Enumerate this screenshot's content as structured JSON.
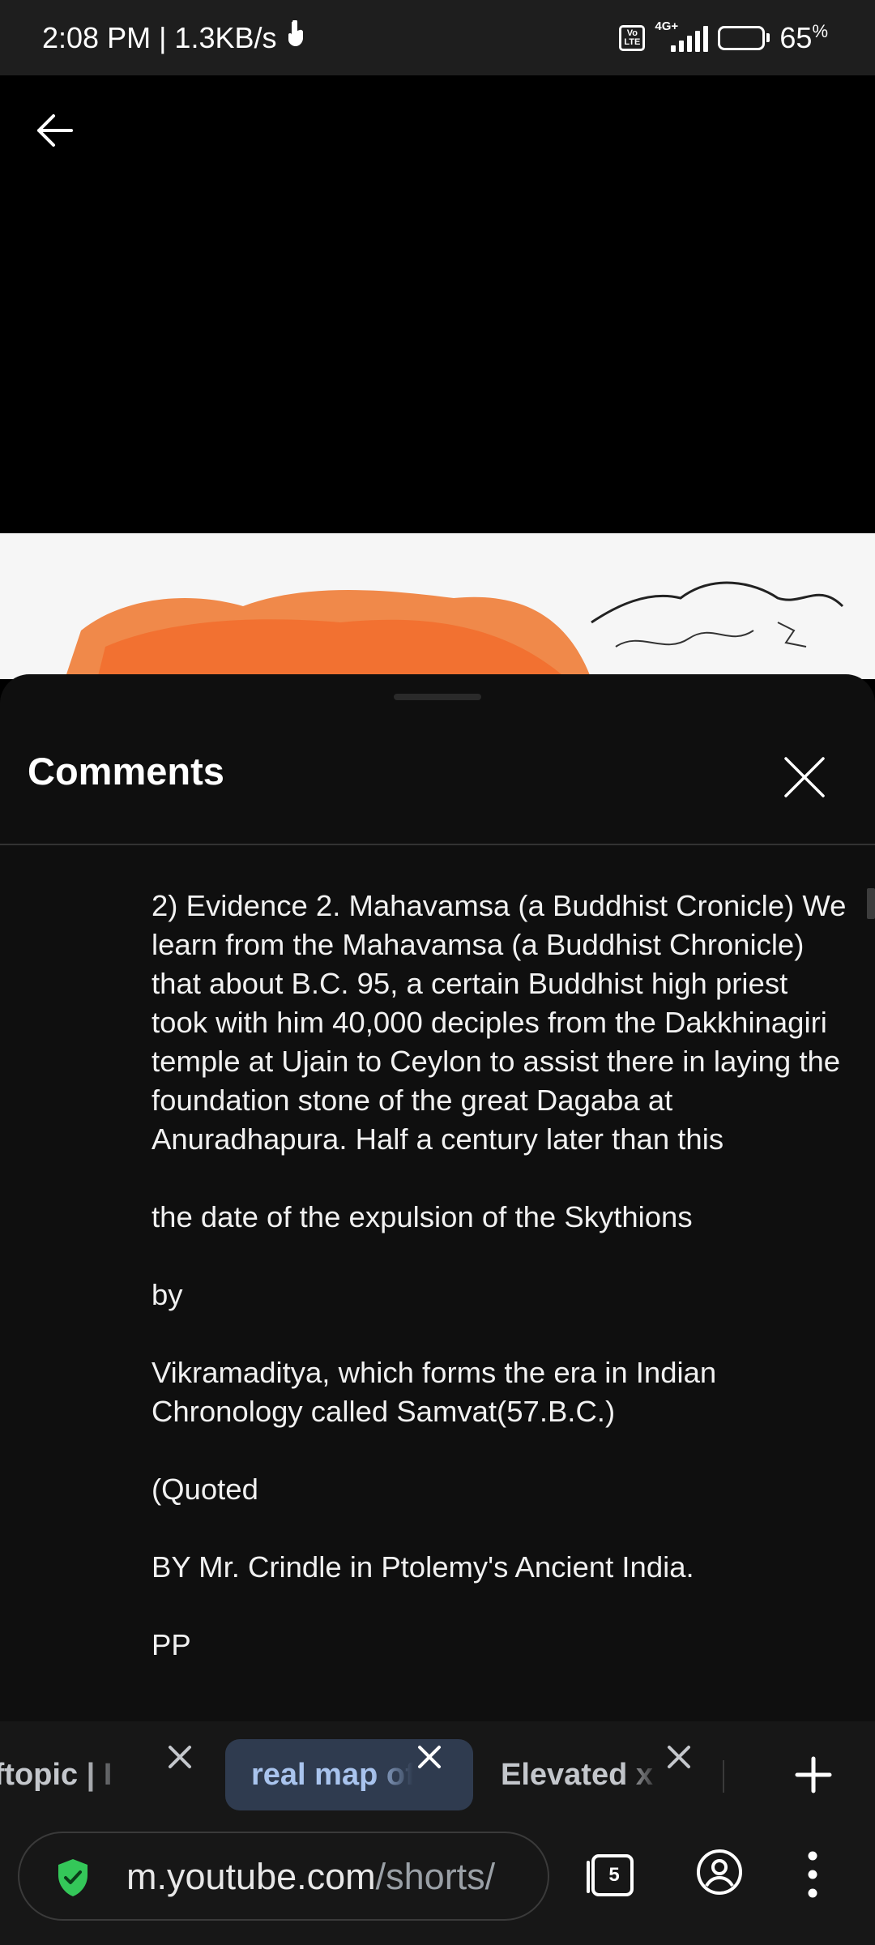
{
  "status_bar": {
    "time_speed": "2:08 PM | 1.3KB/s",
    "volte_label": "Vo LTE",
    "network_type": "4G+",
    "battery_level": 0.65,
    "battery_text": "65",
    "battery_unit": "%"
  },
  "video": {
    "back_icon": "arrow-left-icon"
  },
  "comments_sheet": {
    "title": "Comments",
    "close_icon": "close-icon",
    "paragraphs": [
      "2) Evidence 2. Mahavamsa (a Buddhist Cronicle) We learn from the Mahavamsa (a Buddhist Chronicle) that about B.C. 95, a certain Buddhist high priest took with him 40,000 deciples from the Dakkhinagiri temple at Ujain to Ceylon to assist there in laying the foundation stone of the great Dagaba at Anuradhapura. Half a century later than this",
      "the date of the expulsion of the Skythions",
      "by",
      "Vikramaditya, which forms the era in Indian Chronology called Samvat(57.B.C.)",
      "(Quoted",
      "BY Mr. Crindle in Ptolemy's Ancient India.",
      "PP"
    ]
  },
  "browser": {
    "tabs": [
      {
        "label": "fftopic | I",
        "active": false
      },
      {
        "label": "real map of",
        "active": true
      },
      {
        "label": "Elevated x",
        "active": false
      }
    ],
    "url_domain": "m.youtube.com",
    "url_path": "/shorts/",
    "tab_count": "5",
    "icons": {
      "new_tab": "plus-icon",
      "security": "shield-check-icon",
      "tabs": "tab-switcher-icon",
      "account": "account-circle-icon",
      "menu": "more-vert-icon"
    },
    "colors": {
      "active_tab_bg": "#2f3b4f",
      "active_tab_text": "#a9c4ee",
      "shield_green": "#34c759"
    }
  }
}
